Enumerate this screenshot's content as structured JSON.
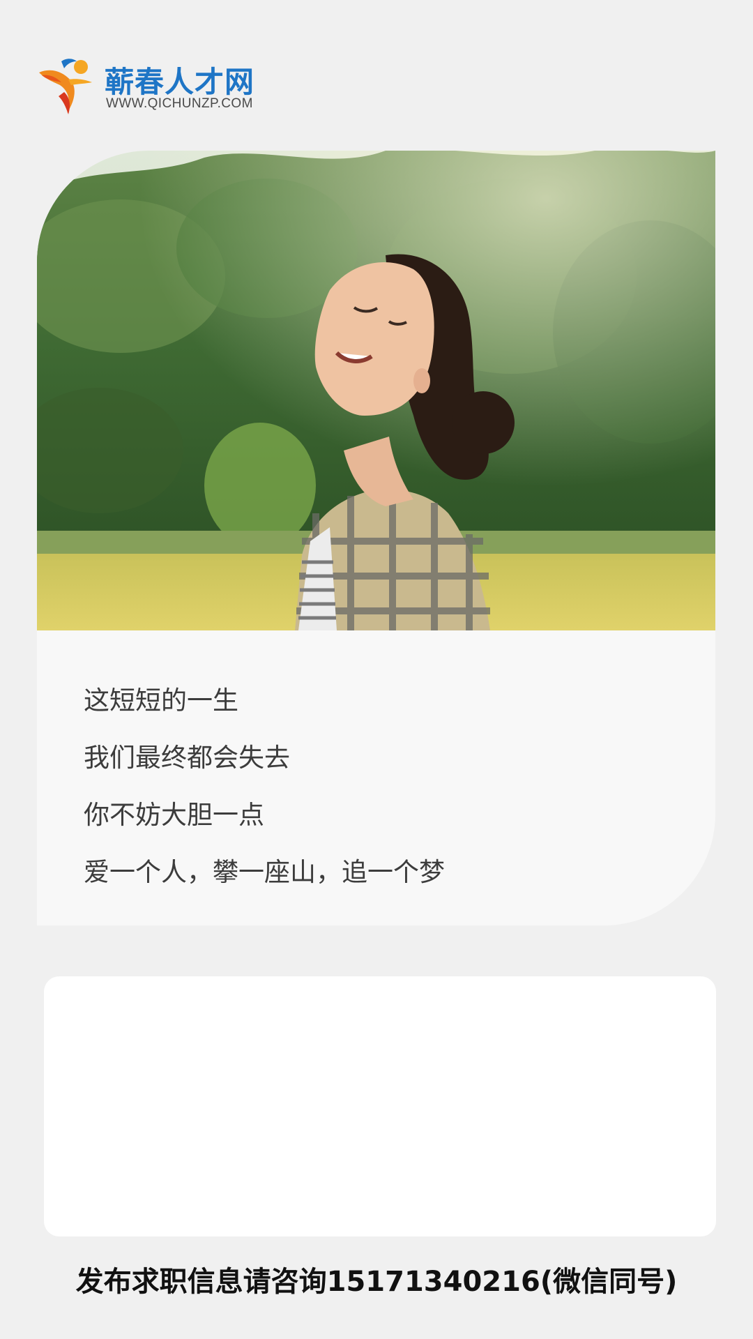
{
  "brand": {
    "name": "蕲春人才网",
    "url": "WWW.QICHUNZP.COM",
    "primary_color": "#1e75c6",
    "logo_icon": "running-person-logo-icon"
  },
  "hero": {
    "photo": "smiling-woman-field-photo",
    "poem_lines": [
      "这短短的一生",
      "我们最终都会失去",
      "你不妨大胆一点",
      "爱一个人，攀一座山，追一个梦"
    ]
  },
  "footer": {
    "contact_text": "发布求职信息请咨询15171340216(微信同号)"
  }
}
